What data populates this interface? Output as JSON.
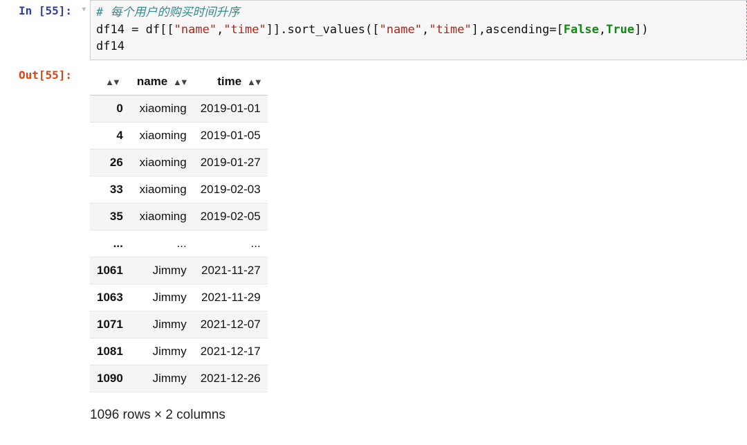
{
  "input": {
    "prompt": "In [55]:",
    "code_comment": "# 每个用户的购买时间升序",
    "line2": {
      "lhs": "df14",
      "eq": " = ",
      "df": "df",
      "br1": "[[",
      "s1": "\"name\"",
      "comma1": ",",
      "s2": "\"time\"",
      "br2": "]].",
      "fn": "sort_values",
      "paren1": "([",
      "s3": "\"name\"",
      "comma2": ",",
      "s4": "\"time\"",
      "br3": "],",
      "kwarg": "ascending",
      "eq2": "=[",
      "kw1": "False",
      "comma3": ",",
      "kw2": "True",
      "tail": "])"
    },
    "line3": "df14"
  },
  "output": {
    "prompt": "Out[55]:",
    "columns": [
      "name",
      "time"
    ],
    "rows": [
      {
        "idx": "0",
        "name": "xiaoming",
        "time": "2019-01-01"
      },
      {
        "idx": "4",
        "name": "xiaoming",
        "time": "2019-01-05"
      },
      {
        "idx": "26",
        "name": "xiaoming",
        "time": "2019-01-27"
      },
      {
        "idx": "33",
        "name": "xiaoming",
        "time": "2019-02-03"
      },
      {
        "idx": "35",
        "name": "xiaoming",
        "time": "2019-02-05"
      },
      {
        "idx": "...",
        "name": "...",
        "time": "..."
      },
      {
        "idx": "1061",
        "name": "Jimmy",
        "time": "2021-11-27"
      },
      {
        "idx": "1063",
        "name": "Jimmy",
        "time": "2021-11-29"
      },
      {
        "idx": "1071",
        "name": "Jimmy",
        "time": "2021-12-07"
      },
      {
        "idx": "1081",
        "name": "Jimmy",
        "time": "2021-12-17"
      },
      {
        "idx": "1090",
        "name": "Jimmy",
        "time": "2021-12-26"
      }
    ],
    "summary": "1096 rows × 2 columns"
  },
  "glyph": {
    "sort": "▲▼",
    "tri": "▼"
  }
}
